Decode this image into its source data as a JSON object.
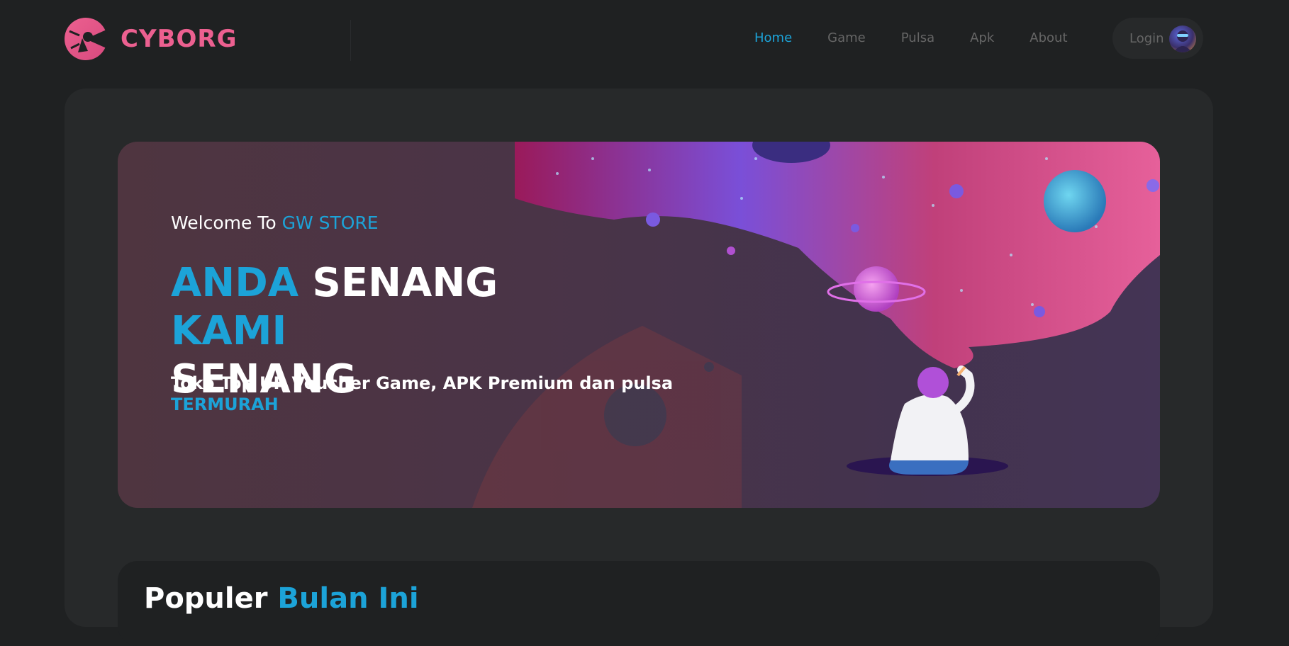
{
  "brand": {
    "name": "CYBORG"
  },
  "nav": {
    "items": [
      {
        "label": "Home",
        "active": true
      },
      {
        "label": "Game",
        "active": false
      },
      {
        "label": "Pulsa",
        "active": false
      },
      {
        "label": "Apk",
        "active": false
      },
      {
        "label": "About",
        "active": false
      }
    ],
    "login_label": "Login"
  },
  "banner": {
    "welcome_prefix": "Welcome To",
    "welcome_highlight": "GW STORE",
    "headline_word1": "ANDA",
    "headline_word2": "SENANG",
    "headline_word3": "KAMI",
    "headline_word4": "SENANG",
    "subline": "Toko Top UP Voucher Game, APK Premium dan pulsa",
    "subline_highlight": "TERMURAH"
  },
  "popular": {
    "title_prefix": "Populer",
    "title_highlight": "Bulan Ini"
  },
  "colors": {
    "background": "#1f2122",
    "panel": "#27292a",
    "accent_blue": "#1ca3d8",
    "brand_pink": "#ec6090",
    "nav_inactive": "#666666"
  },
  "icons": {
    "logo": "cyborg-logo-icon",
    "avatar": "user-avatar"
  }
}
